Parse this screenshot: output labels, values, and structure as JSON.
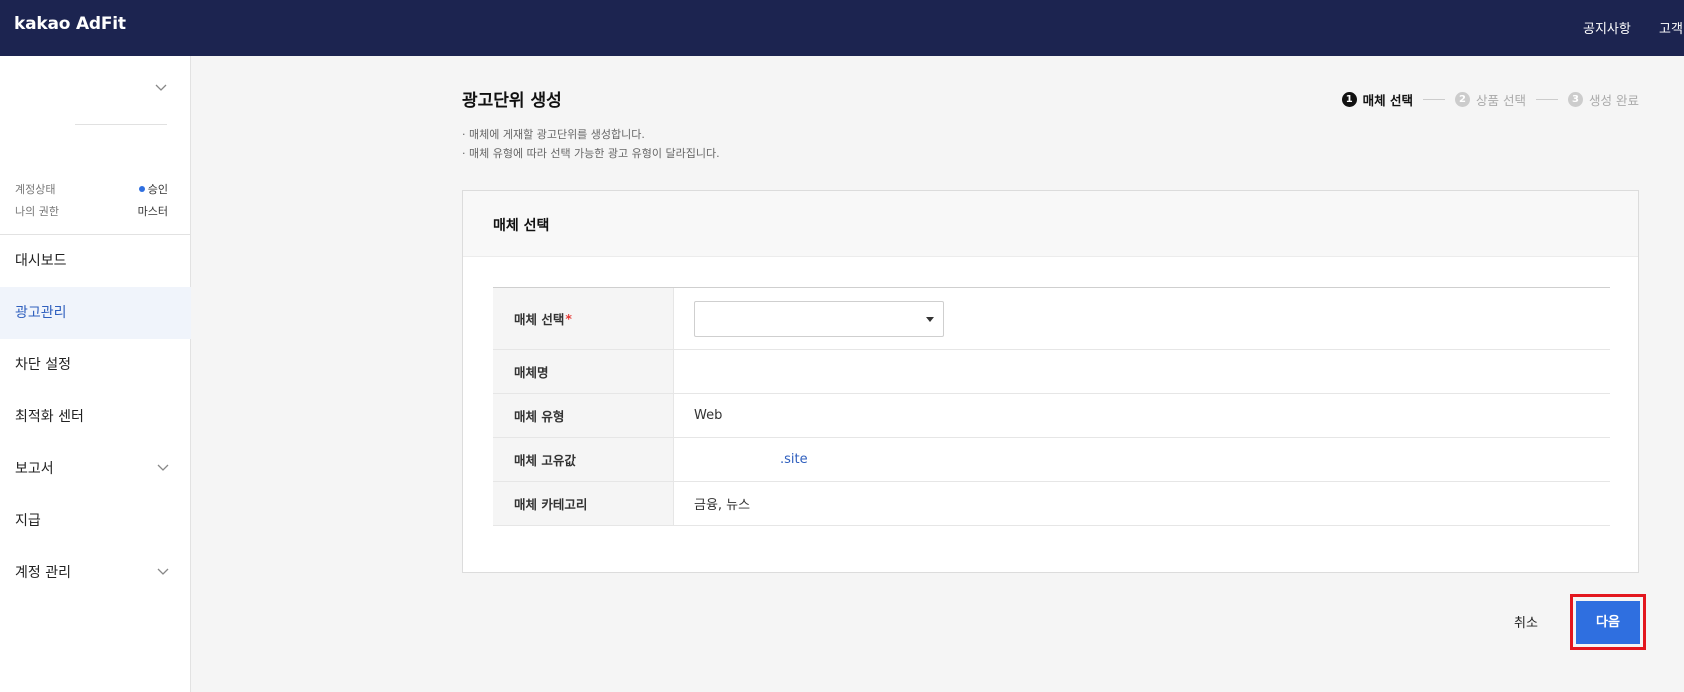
{
  "header": {
    "logo": "kakao AdFit",
    "links": [
      "공지사항",
      "고객"
    ]
  },
  "sidebar": {
    "account": {
      "status_label": "계정상태",
      "status_value": "승인",
      "role_label": "나의 권한",
      "role_value": "마스터"
    },
    "items": [
      {
        "label": "대시보드",
        "active": false,
        "expandable": false
      },
      {
        "label": "광고관리",
        "active": true,
        "expandable": false
      },
      {
        "label": "차단 설정",
        "active": false,
        "expandable": false
      },
      {
        "label": "최적화 센터",
        "active": false,
        "expandable": false
      },
      {
        "label": "보고서",
        "active": false,
        "expandable": true
      },
      {
        "label": "지급",
        "active": false,
        "expandable": false
      },
      {
        "label": "계정 관리",
        "active": false,
        "expandable": true
      }
    ]
  },
  "main": {
    "title": "광고단위 생성",
    "descriptions": [
      "· 매체에 게재할 광고단위를 생성합니다.",
      "· 매체 유형에 따라 선택 가능한 광고 유형이 달라집니다."
    ],
    "steps": [
      {
        "num": "1",
        "label": "매체 선택",
        "current": true
      },
      {
        "num": "2",
        "label": "상품 선택",
        "current": false
      },
      {
        "num": "3",
        "label": "생성 완료",
        "current": false
      }
    ],
    "panel_title": "매체 선택",
    "form": {
      "select_label": "매체 선택",
      "required_mark": "*",
      "select_value": "",
      "name_label": "매체명",
      "name_value": "",
      "type_label": "매체 유형",
      "type_value": "Web",
      "id_label": "매체 고유값",
      "id_value": ".site",
      "category_label": "매체 카테고리",
      "category_value": "금융, 뉴스"
    },
    "buttons": {
      "cancel": "취소",
      "next": "다음"
    }
  },
  "colors": {
    "header_bg": "#1c2450",
    "primary": "#2f6fe0",
    "highlight_outline": "#e3171f"
  }
}
